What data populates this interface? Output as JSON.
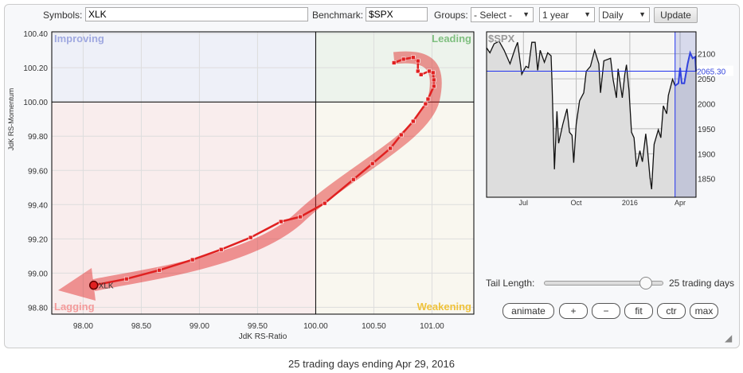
{
  "toolbar": {
    "symbols_label": "Symbols:",
    "symbols_value": "XLK",
    "benchmark_label": "Benchmark:",
    "benchmark_value": "$SPX",
    "groups_label": "Groups:",
    "groups_value": "- Select -",
    "period_value": "1 year",
    "interval_value": "Daily",
    "update_label": "Update"
  },
  "rrg": {
    "quadrants": {
      "improving": "Improving",
      "leading": "Leading",
      "weakening": "Weakening",
      "lagging": "Lagging"
    },
    "colors": {
      "improving_bg": "#eef0f8",
      "leading_bg": "#edf3ec",
      "weakening_bg": "#f9f7ef",
      "lagging_bg": "#f9eded",
      "improving_txt": "#9fa8e0",
      "leading_txt": "#7fbf7f",
      "weakening_txt": "#efc23a",
      "lagging_txt": "#f39a9a",
      "tail": "#e02020"
    },
    "xlabel": "JdK RS-Ratio",
    "ylabel": "JdK RS-Momentum",
    "xlim": [
      97.73,
      101.36
    ],
    "ylim": [
      98.76,
      100.41
    ],
    "xticks": [
      "98.00",
      "98.50",
      "99.00",
      "99.50",
      "100.00",
      "100.50",
      "101.00"
    ],
    "yticks": [
      "100.40",
      "100.20",
      "100.00",
      "99.80",
      "99.60",
      "99.40",
      "99.20",
      "99.00",
      "98.80"
    ],
    "symbol": "XLK",
    "tail": [
      [
        100.673,
        100.229
      ],
      [
        100.755,
        100.25
      ],
      [
        100.838,
        100.26
      ],
      [
        100.879,
        100.24
      ],
      [
        100.879,
        100.18
      ],
      [
        100.906,
        100.16
      ],
      [
        100.977,
        100.18
      ],
      [
        101.009,
        100.171
      ],
      [
        101.016,
        100.129
      ],
      [
        101.016,
        100.092
      ],
      [
        100.966,
        100.017
      ],
      [
        100.945,
        99.989
      ],
      [
        100.838,
        99.887
      ],
      [
        100.735,
        99.808
      ],
      [
        100.642,
        99.729
      ],
      [
        100.488,
        99.64
      ],
      [
        100.324,
        99.547
      ],
      [
        100.077,
        99.408
      ],
      [
        99.868,
        99.329
      ],
      [
        99.701,
        99.301
      ],
      [
        99.44,
        99.208
      ],
      [
        99.187,
        99.138
      ],
      [
        98.94,
        99.078
      ],
      [
        98.655,
        99.017
      ],
      [
        98.372,
        98.966
      ],
      [
        98.091,
        98.929
      ]
    ]
  },
  "chart_data": {
    "type": "line",
    "title": "$SPX",
    "ylim": [
      1813,
      2144
    ],
    "xlim": [
      0,
      250
    ],
    "yticks": [
      "2100",
      "2050",
      "2000",
      "1950",
      "1900",
      "1850"
    ],
    "xticks": [
      {
        "t": 44,
        "label": "Jul"
      },
      {
        "t": 107,
        "label": "Oct"
      },
      {
        "t": 171,
        "label": "2016"
      },
      {
        "t": 231,
        "label": "Apr"
      }
    ],
    "highlight_start": 225,
    "current_value": "2065.30",
    "current": 2065.3,
    "points": [
      [
        0,
        2112
      ],
      [
        4,
        2102
      ],
      [
        9,
        2120
      ],
      [
        15,
        2125
      ],
      [
        21,
        2107
      ],
      [
        28,
        2080
      ],
      [
        34,
        2110
      ],
      [
        37,
        2123
      ],
      [
        42,
        2059
      ],
      [
        47,
        2075
      ],
      [
        50,
        2072
      ],
      [
        54,
        2123
      ],
      [
        58,
        2123
      ],
      [
        61,
        2067
      ],
      [
        64,
        2107
      ],
      [
        69,
        2083
      ],
      [
        73,
        2102
      ],
      [
        77,
        2096
      ],
      [
        78,
        2049
      ],
      [
        81,
        1869
      ],
      [
        84,
        1985
      ],
      [
        86,
        1921
      ],
      [
        91,
        1959
      ],
      [
        96,
        1990
      ],
      [
        99,
        1943
      ],
      [
        102,
        1937
      ],
      [
        104,
        1882
      ],
      [
        107,
        1959
      ],
      [
        111,
        2006
      ],
      [
        116,
        2022
      ],
      [
        119,
        2065
      ],
      [
        124,
        2075
      ],
      [
        129,
        2107
      ],
      [
        134,
        2080
      ],
      [
        136,
        2022
      ],
      [
        140,
        2086
      ],
      [
        148,
        2091
      ],
      [
        151,
        2049
      ],
      [
        155,
        2012
      ],
      [
        157,
        2070
      ],
      [
        162,
        2012
      ],
      [
        165,
        2059
      ],
      [
        167,
        2078
      ],
      [
        170,
        2027
      ],
      [
        173,
        1943
      ],
      [
        176,
        1932
      ],
      [
        179,
        1874
      ],
      [
        183,
        1906
      ],
      [
        186,
        1884
      ],
      [
        190,
        1940
      ],
      [
        192,
        1910
      ],
      [
        195,
        1853
      ],
      [
        197,
        1829
      ],
      [
        200,
        1919
      ],
      [
        205,
        1948
      ],
      [
        208,
        1932
      ],
      [
        211,
        1996
      ],
      [
        215,
        1980
      ],
      [
        217,
        2017
      ],
      [
        222,
        2049
      ],
      [
        225,
        2036
      ],
      [
        229,
        2041
      ],
      [
        231,
        2072
      ],
      [
        233,
        2041
      ],
      [
        236,
        2041
      ],
      [
        240,
        2080
      ],
      [
        243,
        2102
      ],
      [
        246,
        2091
      ],
      [
        249,
        2094
      ],
      [
        250,
        2065
      ]
    ]
  },
  "controls": {
    "tail_label": "Tail Length:",
    "tail_value": "25 trading days",
    "tail_fraction": 0.86,
    "animate": "animate",
    "plus": "+",
    "minus": "−",
    "fit": "fit",
    "ctr": "ctr",
    "max": "max"
  },
  "caption": "25 trading days ending Apr 29, 2016"
}
